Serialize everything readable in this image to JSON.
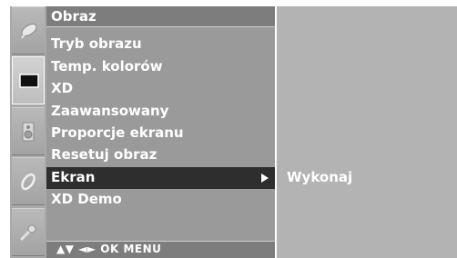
{
  "menu": {
    "title": "Obraz",
    "items": [
      {
        "label": "Tryb obrazu"
      },
      {
        "label": "Temp. kolorów"
      },
      {
        "label": "XD"
      },
      {
        "label": "Zaawansowany"
      },
      {
        "label": "Proporcje ekranu"
      },
      {
        "label": "Resetuj obraz"
      },
      {
        "label": "Ekran",
        "selected": true
      },
      {
        "label": "XD Demo"
      }
    ],
    "nav_hint": "▲▼ ◄► OK MENU"
  },
  "submenu": {
    "items": [
      {
        "label": "Wykonaj"
      }
    ]
  },
  "icons": [
    {
      "name": "satellite-dish-icon"
    },
    {
      "name": "screen-icon",
      "active": true
    },
    {
      "name": "speaker-icon"
    },
    {
      "name": "clock-icon"
    },
    {
      "name": "key-icon"
    }
  ],
  "colors": {
    "menu_background": "#9a9a9a",
    "selected_row": "#2e2e2e",
    "submenu_background": "#b3b3b3",
    "text": "#ffffff"
  }
}
